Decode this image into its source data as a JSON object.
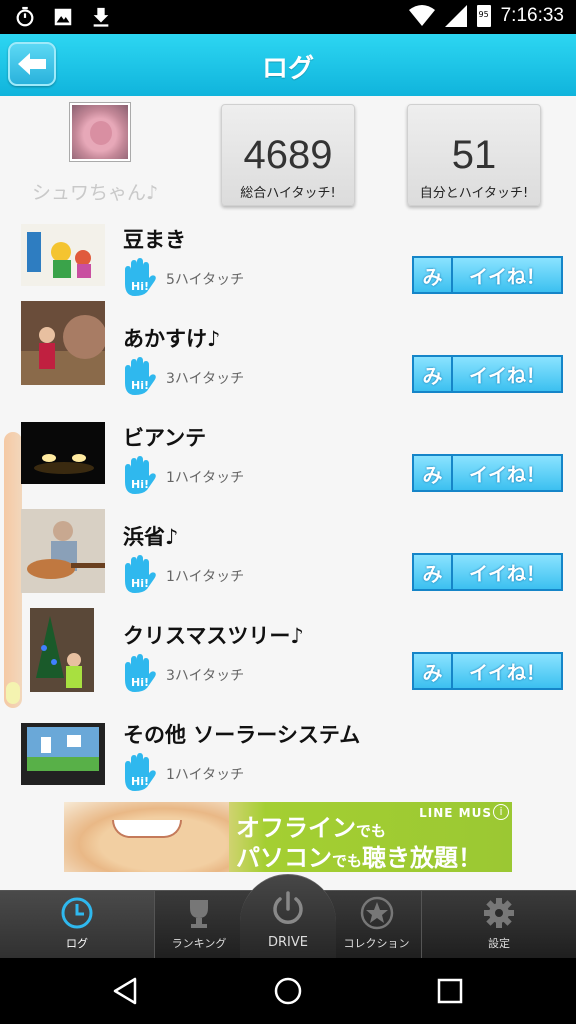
{
  "status_bar": {
    "time": "7:16:33",
    "battery": "95",
    "icons_left": [
      "timer-icon",
      "image-icon",
      "download-icon"
    ],
    "icons_right": [
      "wifi-icon",
      "signal-icon",
      "battery-icon"
    ]
  },
  "app_bar": {
    "title": "ログ",
    "back_icon": "back-arrow-icon",
    "color": "#1fc4e8"
  },
  "profile": {
    "username": "シュワちゃん♪",
    "total_label": "総合ハイタッチ!",
    "total_value": "4689",
    "self_label": "自分とハイタッチ!",
    "self_value": "51"
  },
  "items": [
    {
      "title": "豆まき",
      "count": "5ハイタッチ",
      "like_prefix": "み",
      "like_label": "イイね！",
      "has_like": true
    },
    {
      "title": "あかすけ♪",
      "count": "3ハイタッチ",
      "like_prefix": "み",
      "like_label": "イイね！",
      "has_like": true
    },
    {
      "title": "ビアンテ",
      "count": "1ハイタッチ",
      "like_prefix": "み",
      "like_label": "イイね！",
      "has_like": true
    },
    {
      "title": "浜省♪",
      "count": "1ハイタッチ",
      "like_prefix": "み",
      "like_label": "イイね！",
      "has_like": true
    },
    {
      "title": "クリスマスツリー♪",
      "count": "3ハイタッチ",
      "like_prefix": "み",
      "like_label": "イイね！",
      "has_like": true
    },
    {
      "title": "その他 ソーラーシステム",
      "count": "1ハイタッチ",
      "like_prefix": "",
      "like_label": "",
      "has_like": false
    }
  ],
  "ad": {
    "brand": "LINE MUS",
    "line1": "オフライン",
    "line1_small": "でも",
    "line2": "パソコン",
    "line2_small": "でも",
    "line2_rest": "聴き放題！",
    "info_icon": "info-icon"
  },
  "tabs": {
    "log": "ログ",
    "ranking": "ランキング",
    "drive": "DRIVE",
    "collection": "コレクション",
    "settings": "設定"
  },
  "colors": {
    "accent": "#1fc4e8",
    "like_button": "#3cc0f0",
    "hi_icon": "#2fb8ee"
  }
}
